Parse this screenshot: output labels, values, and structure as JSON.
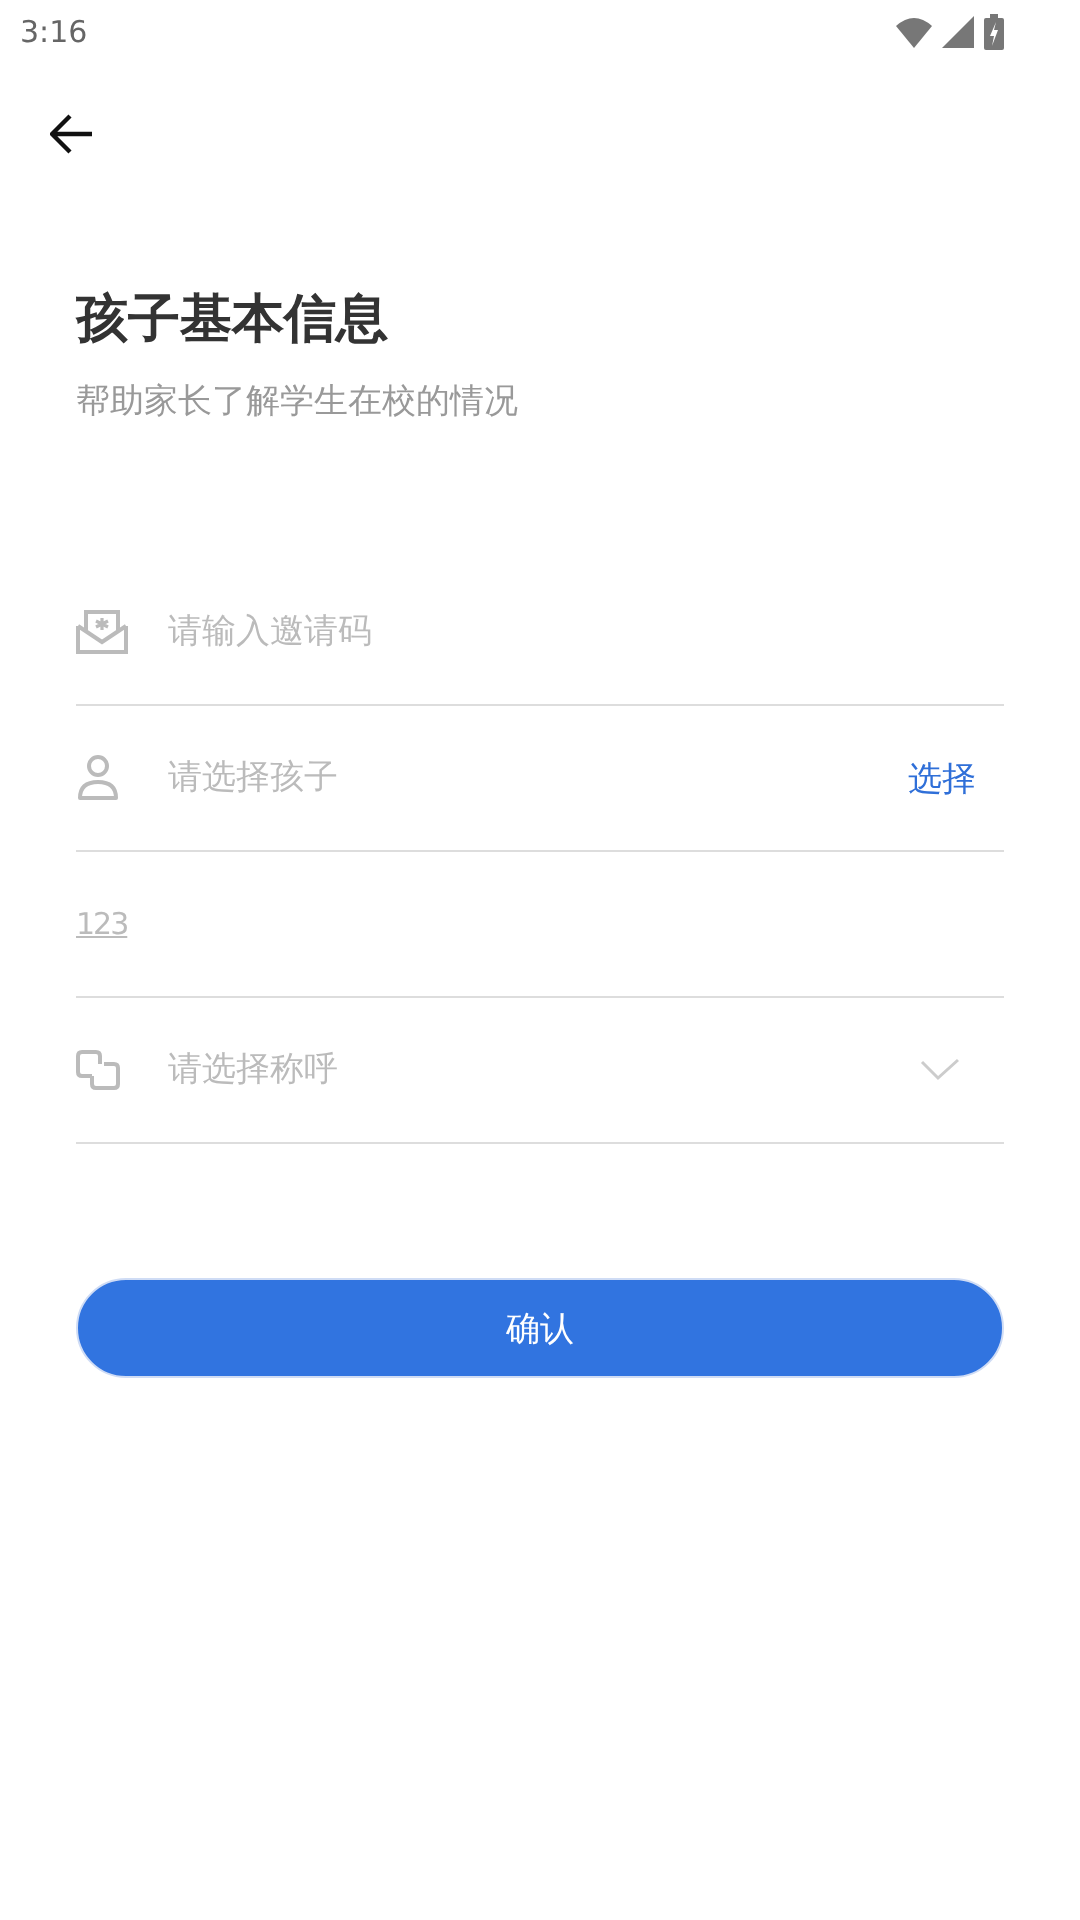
{
  "status_bar": {
    "time": "3:16"
  },
  "title": "孩子基本信息",
  "subtitle": "帮助家长了解学生在校的情况",
  "fields": [
    {
      "kind": "invite",
      "placeholder": "请输入邀请码"
    },
    {
      "kind": "child",
      "placeholder": "请选择孩子",
      "action": "选择"
    },
    {
      "kind": "number",
      "icon_text": "123"
    },
    {
      "kind": "relation",
      "placeholder": "请选择称呼"
    }
  ],
  "confirm_button": "确认"
}
